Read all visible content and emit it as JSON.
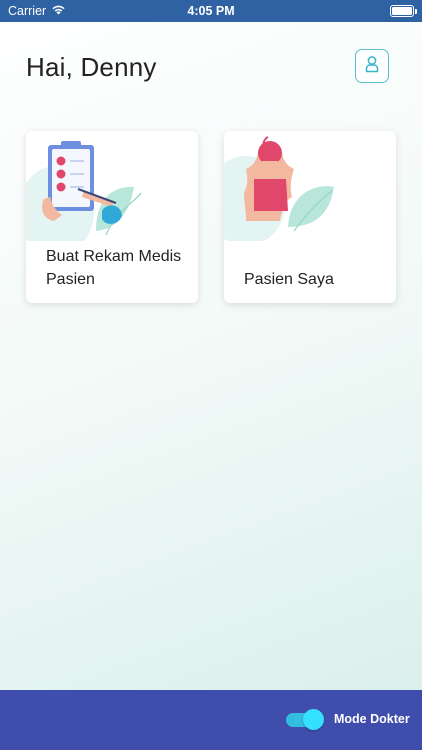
{
  "status_bar": {
    "carrier": "Carrier",
    "time": "4:05 PM",
    "icons": [
      "wifi-icon",
      "battery-icon"
    ]
  },
  "header": {
    "greeting": "Hai, Denny",
    "profile_icon": "user-icon"
  },
  "cards": [
    {
      "label": "Buat Rekam Medis Pasien",
      "illustration": "clipboard-checklist-illustration"
    },
    {
      "label": "Pasien Saya",
      "illustration": "patient-back-illustration"
    }
  ],
  "bottom_bar": {
    "mode_label": "Mode Dokter",
    "toggle_on": true
  },
  "colors": {
    "status_bar": "#2f62a3",
    "bottom_bar": "#3f4eac",
    "accent": "#35e0ff",
    "card_text": "#222222",
    "profile_border": "#5bbfcf"
  }
}
